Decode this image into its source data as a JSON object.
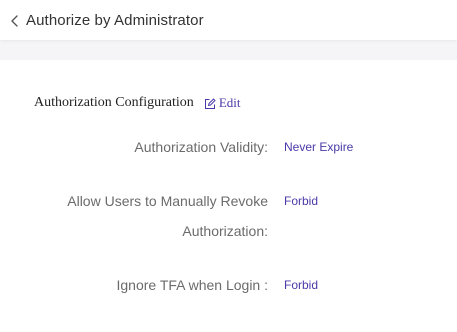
{
  "header": {
    "back_icon": "chevron-left-icon",
    "title": "Authorize by Administrator"
  },
  "section": {
    "title": "Authorization Configuration",
    "edit_icon": "edit-icon",
    "edit_label": "Edit"
  },
  "settings": [
    {
      "label": "Authorization Validity:",
      "value": "Never Expire"
    },
    {
      "label_line1": "Allow Users to Manually Revoke",
      "label_line2": "Authorization:",
      "value": "Forbid"
    },
    {
      "label": "Ignore TFA when Login :",
      "value": "Forbid"
    }
  ],
  "colors": {
    "accent": "#4a3aa8",
    "label": "#6b6b6b",
    "background": "#f5f5f7"
  }
}
